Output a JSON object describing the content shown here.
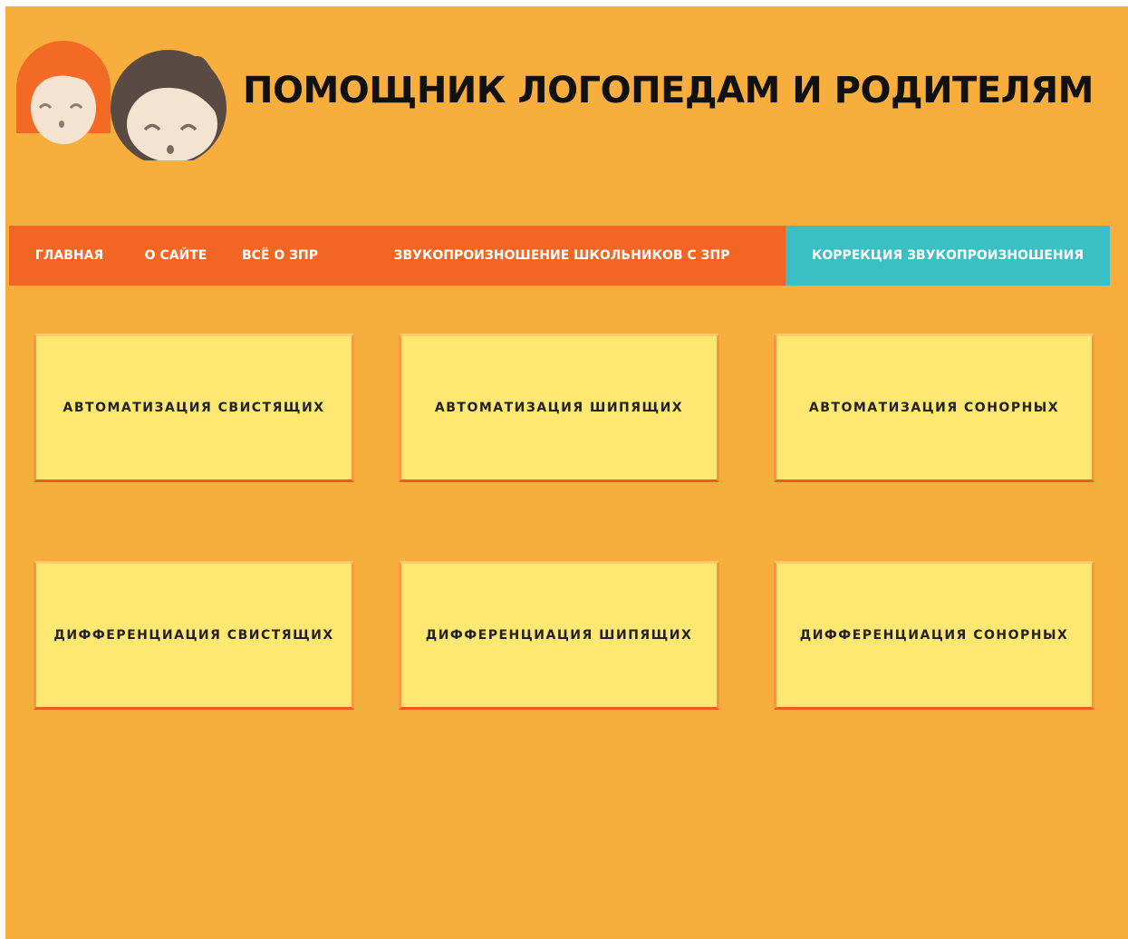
{
  "header": {
    "title": "ПОМОЩНИК ЛОГОПЕДАМ И РОДИТЕЛЯМ",
    "logo_icon": "children-faces-icon"
  },
  "nav": {
    "items": [
      {
        "label": "ГЛАВНАЯ"
      },
      {
        "label": "О САЙТЕ"
      },
      {
        "label": "ВСЁ О ЗПР"
      },
      {
        "label": "ЗВУКОПРОИЗНОШЕНИЕ ШКОЛЬНИКОВ С ЗПР"
      },
      {
        "label": "КОРРЕКЦИЯ ЗВУКОПРОИЗНОШЕНИЯ",
        "active": true
      }
    ]
  },
  "cards": [
    {
      "label": "автоматизация свистящих"
    },
    {
      "label": "автоматизация шипящих"
    },
    {
      "label": "автоматизация сонорных"
    },
    {
      "label": "дифференциация свистящих"
    },
    {
      "label": "дифференциация шипящих"
    },
    {
      "label": "дифференциация сонорных"
    }
  ],
  "colors": {
    "page_background": "#f8ae3c",
    "nav_background": "#f26522",
    "nav_active": "#3abfc4",
    "card_background": "#ffe872",
    "card_border": "#f05a22"
  }
}
